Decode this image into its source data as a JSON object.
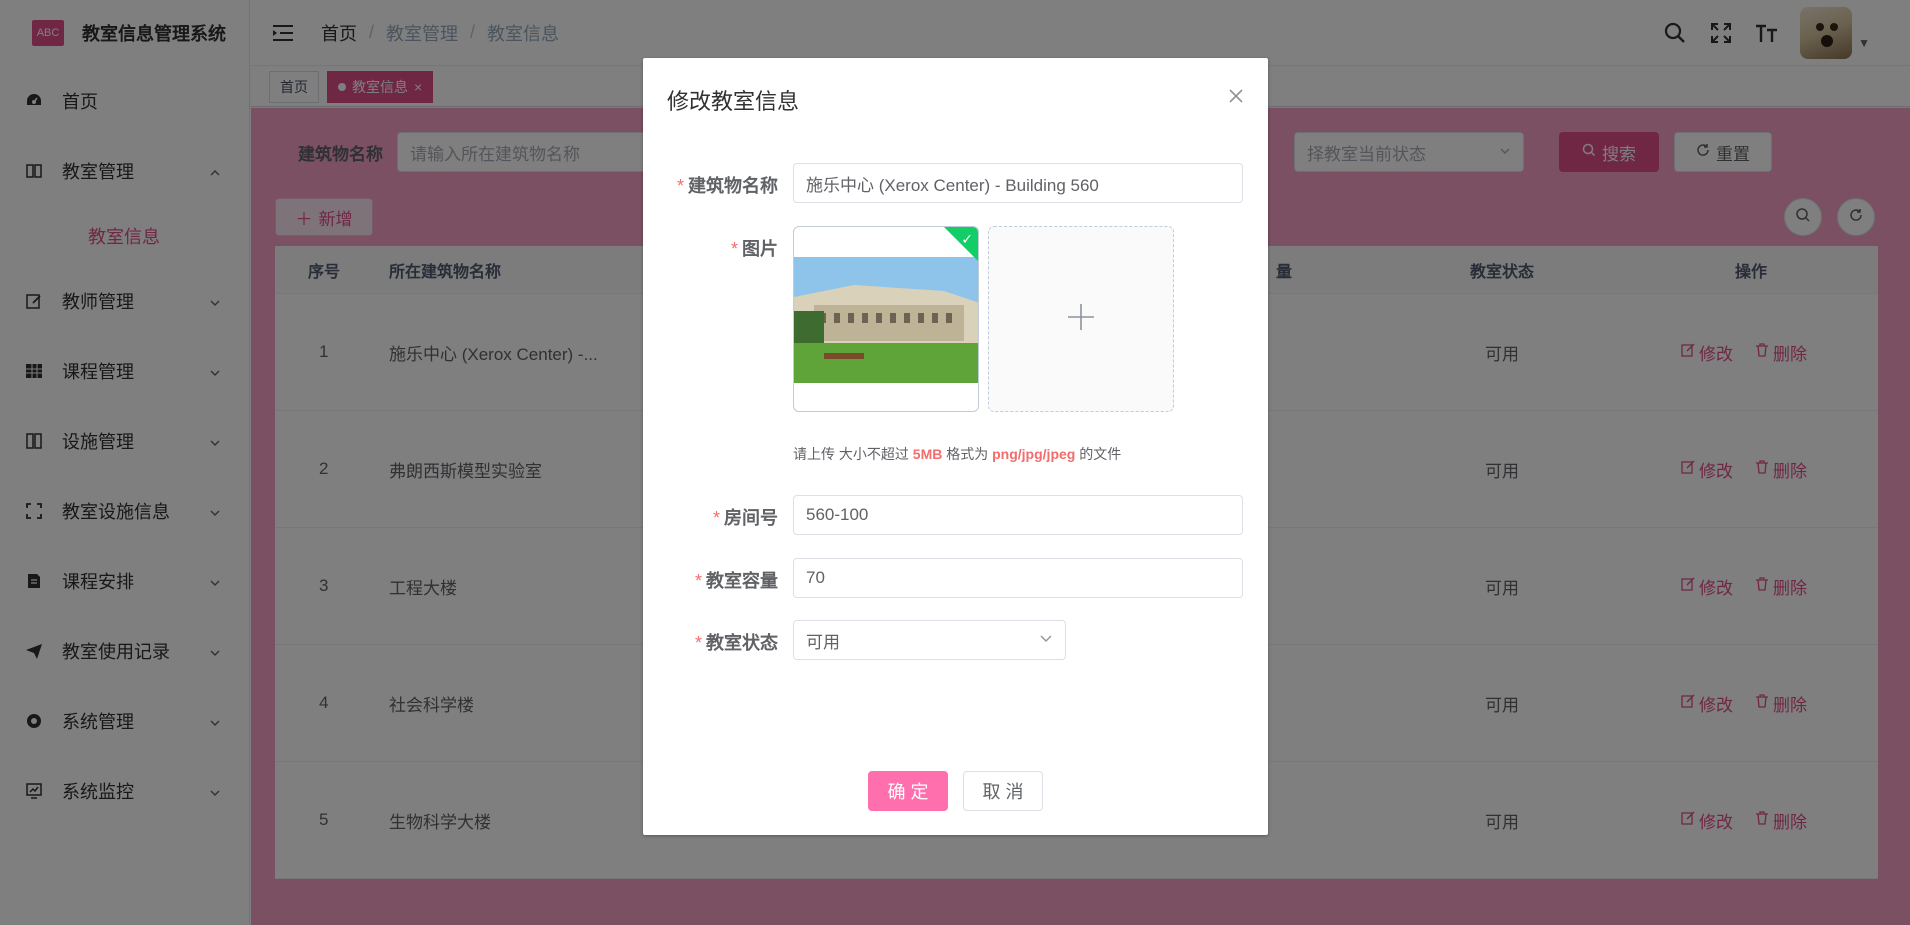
{
  "app": {
    "logo_text": "ABC",
    "title": "教室信息管理系统"
  },
  "sidebar": {
    "items": [
      {
        "label": "首页",
        "icon": "dashboard-icon"
      },
      {
        "label": "教室管理",
        "icon": "book-icon",
        "expanded": true,
        "children": [
          {
            "label": "教室信息"
          }
        ]
      },
      {
        "label": "教师管理",
        "icon": "edit-icon"
      },
      {
        "label": "课程管理",
        "icon": "table-icon"
      },
      {
        "label": "设施管理",
        "icon": "building-icon"
      },
      {
        "label": "教室设施信息",
        "icon": "fullscreen-icon"
      },
      {
        "label": "课程安排",
        "icon": "document-icon"
      },
      {
        "label": "教室使用记录",
        "icon": "send-icon"
      },
      {
        "label": "系统管理",
        "icon": "gear-icon"
      },
      {
        "label": "系统监控",
        "icon": "monitor-icon"
      }
    ]
  },
  "header": {
    "breadcrumb": [
      "首页",
      "教室管理",
      "教室信息"
    ],
    "separator": "/"
  },
  "tags": [
    {
      "label": "首页",
      "active": false
    },
    {
      "label": "教室信息",
      "active": true,
      "close": "×"
    }
  ],
  "search": {
    "building_label": "建筑物名称",
    "building_placeholder": "请输入所在建筑物名称",
    "status_placeholder": "择教室当前状态",
    "search_btn": "搜索",
    "reset_btn": "重置",
    "add_btn": "新增"
  },
  "table": {
    "headers": {
      "index": "序号",
      "building": "所在建筑物名称",
      "capacity_partial": "量",
      "status": "教室状态",
      "ops": "操作"
    },
    "rows": [
      {
        "index": "1",
        "building": "施乐中心 (Xerox Center) -...",
        "status": "可用"
      },
      {
        "index": "2",
        "building": "弗朗西斯模型实验室",
        "status": "可用"
      },
      {
        "index": "3",
        "building": "工程大楼",
        "status": "可用"
      },
      {
        "index": "4",
        "building": "社会科学楼",
        "status": "可用"
      },
      {
        "index": "5",
        "building": "生物科学大楼",
        "status": "可用"
      }
    ],
    "edit_label": "修改",
    "delete_label": "删除"
  },
  "dialog": {
    "title": "修改教室信息",
    "close": "×",
    "fields": {
      "building": {
        "label": "建筑物名称",
        "value": "施乐中心 (Xerox Center) - Building 560"
      },
      "image": {
        "label": "图片"
      },
      "room": {
        "label": "房间号",
        "value": "560-100"
      },
      "capacity": {
        "label": "教室容量",
        "value": "70"
      },
      "status": {
        "label": "教室状态",
        "value": "可用"
      }
    },
    "hint": {
      "prefix": "请上传 大小不超过 ",
      "size": "5MB",
      "mid": " 格式为 ",
      "formats": "png/jpg/jpeg",
      "suffix": " 的文件"
    },
    "confirm": "确 定",
    "cancel": "取 消",
    "required_mark": "*"
  },
  "colors": {
    "primary": "#e04e89",
    "success": "#13ce66",
    "danger": "#f56c6c"
  }
}
